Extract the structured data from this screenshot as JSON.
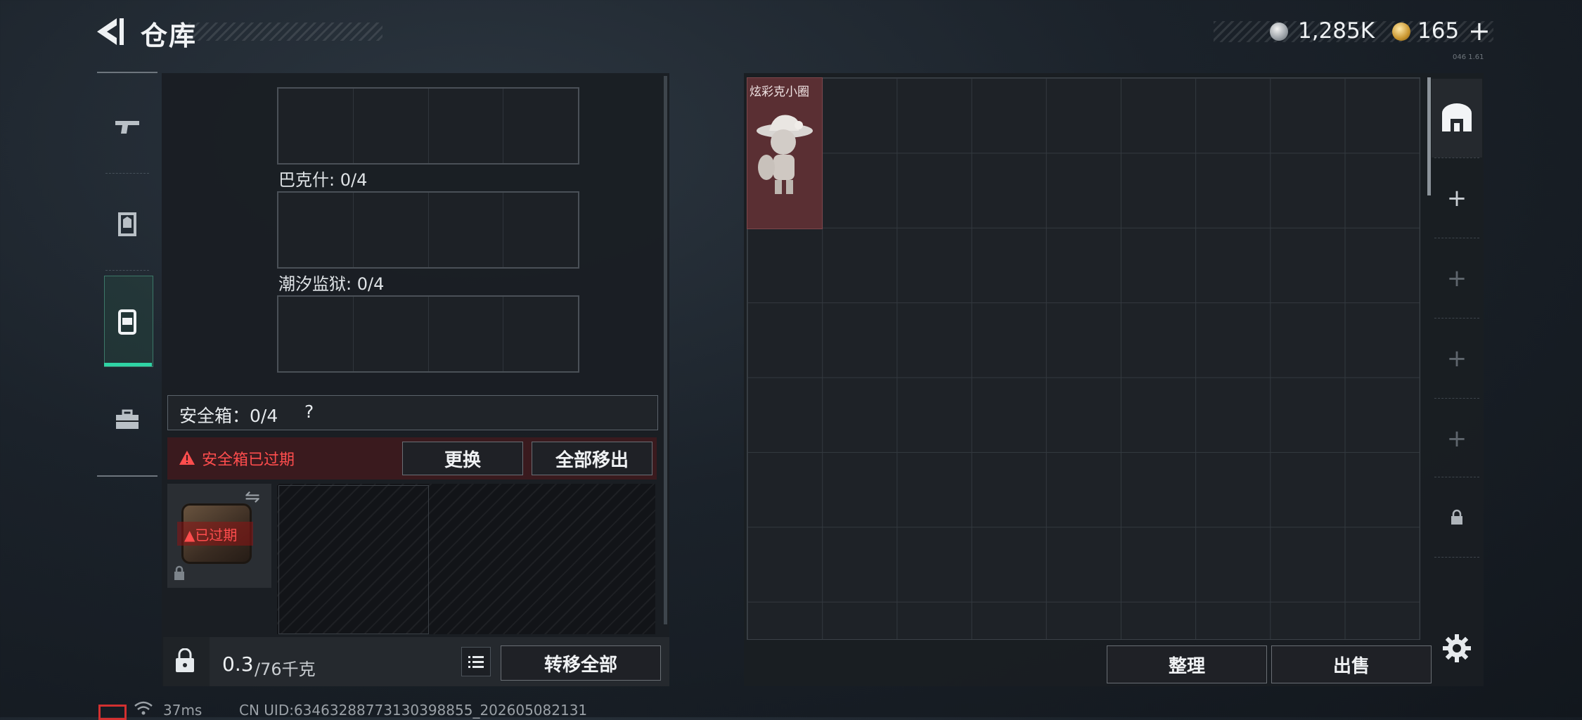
{
  "header": {
    "title": "仓库",
    "currency": {
      "silver_value": "1,285K",
      "gold_value": "165",
      "gold_plus": "+"
    },
    "tiny_label": "046 1.61"
  },
  "nav": {
    "items": [
      {
        "icon": "gun-icon"
      },
      {
        "icon": "armor-icon"
      },
      {
        "icon": "backpack-icon",
        "active": true
      },
      {
        "icon": "toolbox-icon"
      }
    ]
  },
  "collections": [
    {
      "label": ""
    },
    {
      "label": "巴克什: 0/4"
    },
    {
      "label": "潮汐监狱: 0/4"
    }
  ],
  "safe_box": {
    "title": "安全箱：0/4",
    "help": "?",
    "expired_notice": "安全箱已过期",
    "replace_button": "更换",
    "move_all_button": "全部移出",
    "case_badge": "已过期"
  },
  "capacity": {
    "value": "0.3",
    "max": "/76千克",
    "transfer_button": "转移全部"
  },
  "storage": {
    "item_name": "炫彩克小圈",
    "sort_button": "整理",
    "sell_button": "出售",
    "side_add_labels": [
      "+",
      "+",
      "+",
      "+"
    ]
  },
  "status": {
    "ping": "37ms",
    "uid": "CN UID:63463288773130398855_202605082131"
  },
  "colors": {
    "accent_green": "#2fd4a5",
    "warning_red": "#ff4d4d",
    "item_bg": "#5a2f33"
  }
}
